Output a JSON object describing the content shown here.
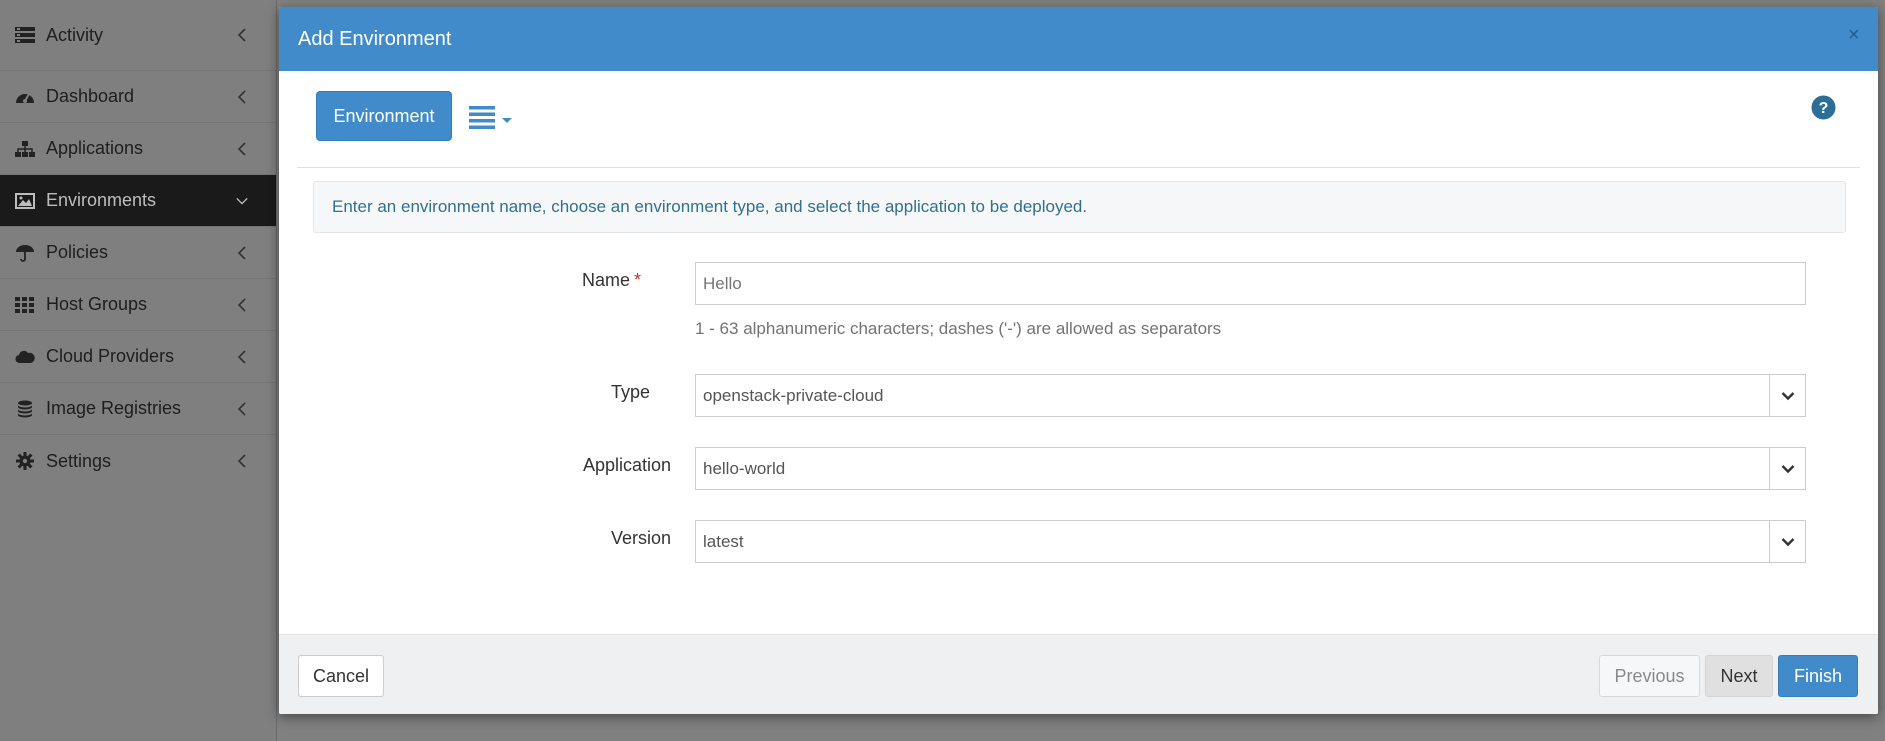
{
  "sidebar": {
    "items": [
      {
        "label": "Activity",
        "icon": "list-icon",
        "active": false
      },
      {
        "label": "Dashboard",
        "icon": "dashboard-icon",
        "active": false
      },
      {
        "label": "Applications",
        "icon": "sitemap-icon",
        "active": false
      },
      {
        "label": "Environments",
        "icon": "picture-icon",
        "active": true
      },
      {
        "label": "Policies",
        "icon": "umbrella-icon",
        "active": false
      },
      {
        "label": "Host Groups",
        "icon": "grid-icon",
        "active": false
      },
      {
        "label": "Cloud Providers",
        "icon": "cloud-icon",
        "active": false
      },
      {
        "label": "Image Registries",
        "icon": "database-icon",
        "active": false
      },
      {
        "label": "Settings",
        "icon": "gear-icon",
        "active": false
      }
    ]
  },
  "modal": {
    "title": "Add Environment",
    "close_label": "×",
    "tab_button": "Environment",
    "alert": "Enter an environment name, choose an environment type, and select the application to be deployed.",
    "form": {
      "name_label": "Name",
      "required_mark": "*",
      "name_placeholder": "Hello",
      "name_help": "1 - 63 alphanumeric characters; dashes ('-') are allowed as separators",
      "type_label": "Type",
      "type_value": "openstack-private-cloud",
      "application_label": "Application",
      "application_value": "hello-world",
      "version_label": "Version",
      "version_value": "latest"
    },
    "footer": {
      "cancel": "Cancel",
      "previous": "Previous",
      "next": "Next",
      "finish": "Finish"
    }
  },
  "colors": {
    "primary": "#428bca",
    "sidebar_active": "#1a1a1a",
    "overlay": "#808080"
  }
}
